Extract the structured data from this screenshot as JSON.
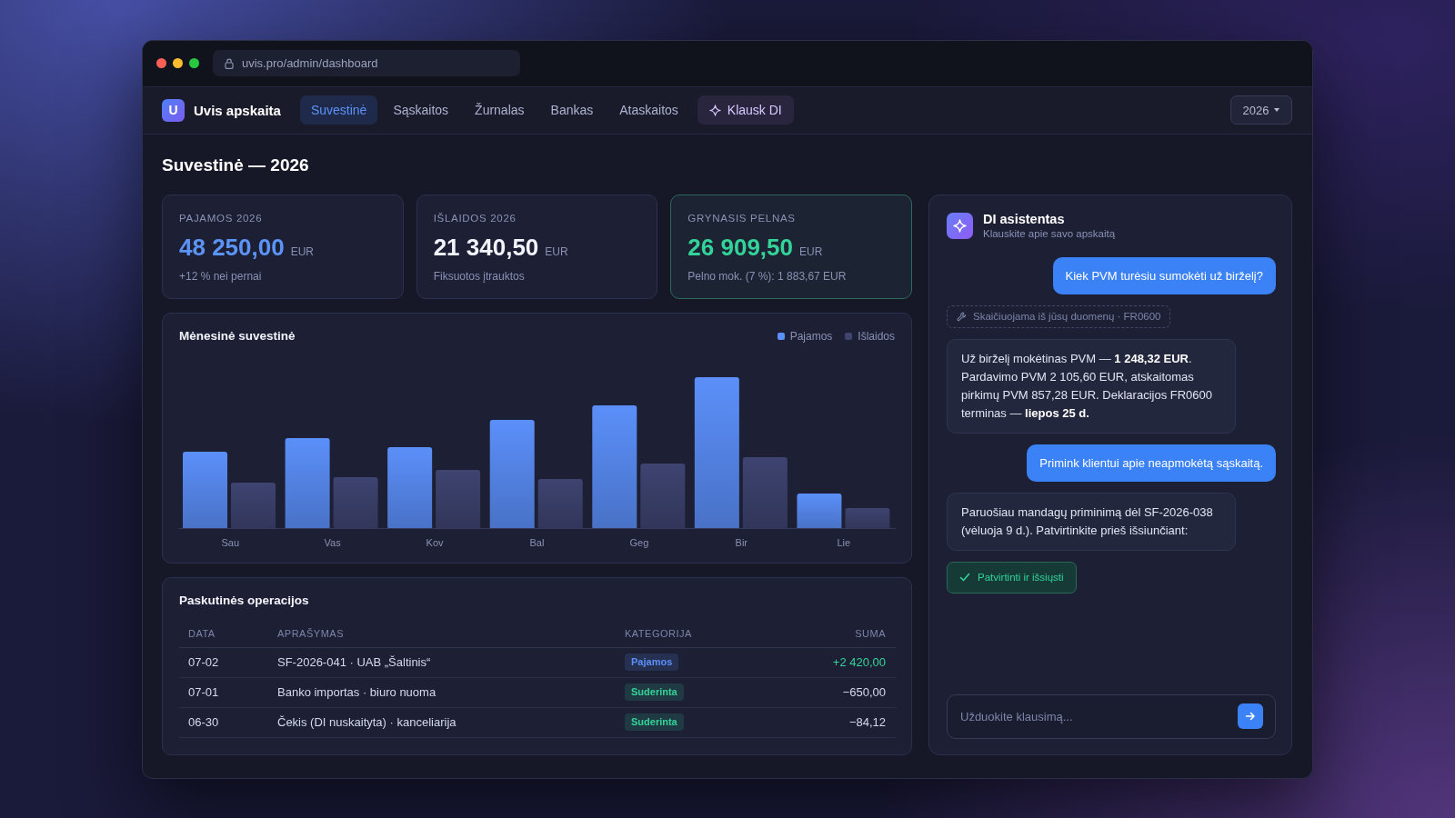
{
  "browser": {
    "url": "uvis.pro/admin/dashboard"
  },
  "app": {
    "logo_letter": "U",
    "name": "Uvis apskaita"
  },
  "tabs": [
    {
      "label": "Suvestinė",
      "selected": true,
      "kind": "page"
    },
    {
      "label": "Sąskaitos",
      "selected": false,
      "kind": "page"
    },
    {
      "label": "Žurnalas",
      "selected": false,
      "kind": "page"
    },
    {
      "label": "Bankas",
      "selected": false,
      "kind": "page"
    },
    {
      "label": "Ataskaitos",
      "selected": false,
      "kind": "page"
    },
    {
      "label": "Klausk DI",
      "selected": false,
      "kind": "assistant"
    }
  ],
  "year_select": {
    "value": "2026"
  },
  "page_title": "Suvestinė — 2026",
  "stats": [
    {
      "label": "PAJAMOS 2026",
      "value": "48 250,00",
      "unit": "EUR",
      "note": "+12 % nei pernai",
      "kind": "income"
    },
    {
      "label": "IŠLAIDOS 2026",
      "value": "21 340,50",
      "unit": "EUR",
      "note": "Fiksuotos įtrauktos",
      "kind": "expense"
    },
    {
      "label": "GRYNASIS PELNAS",
      "value": "26 909,50",
      "unit": "EUR",
      "note": "Pelno mok. (7 %): 1 883,67 EUR",
      "kind": "profit"
    }
  ],
  "monthly_chart": {
    "title": "Mėnesinė suvestinė",
    "legend": [
      {
        "label": "Pajamos",
        "color": "#5b8ff9"
      },
      {
        "label": "Išlaidos",
        "color": "#3e4370"
      }
    ],
    "months": [
      "Sau",
      "Vas",
      "Kov",
      "Bal",
      "Geg",
      "Bir",
      "Lie"
    ]
  },
  "transactions": {
    "title": "Paskutinės operacijos",
    "columns": [
      "DATA",
      "APRAŠYMAS",
      "KATEGORIJA",
      "SUMA"
    ],
    "rows": [
      {
        "date": "07-02",
        "description": "SF-2026-041 · UAB „Šaltinis“",
        "category": {
          "label": "Pajamos",
          "color": "#5b8ff9"
        },
        "amount": "+2 420,00",
        "kind": "income"
      },
      {
        "date": "07-01",
        "description": "Banko importas · biuro nuoma",
        "category": {
          "label": "Suderinta",
          "color": "#34d399"
        },
        "amount": "−650,00",
        "kind": "expense"
      },
      {
        "date": "06-30",
        "description": "Čekis (DI nuskaityta) · kanceliarija",
        "category": {
          "label": "Suderinta",
          "color": "#34d399"
        },
        "amount": "−84,12",
        "kind": "expense"
      }
    ]
  },
  "assistant": {
    "title": "DI asistentas",
    "subtitle": "Klauskite apie savo apskaitą",
    "messages": [
      {
        "kind": "user",
        "text": "Kiek PVM turėsiu sumokėti už birželį?"
      },
      {
        "kind": "tool",
        "text": "Skaičiuojama iš jūsų duomenų · FR0600"
      },
      {
        "kind": "bot",
        "text": "Už birželį mokėtinas PVM — **1 248,32 EUR**. Pardavimo PVM 2 105,60 EUR, atskaitomas pirkimų PVM 857,28 EUR. Deklaracijos FR0600 terminas — **liepos 25 d.**"
      },
      {
        "kind": "user",
        "text": "Primink klientui apie neapmokėtą sąskaitą."
      },
      {
        "kind": "bot",
        "text": "Paruošiau mandagų priminimą dėl SF-2026-038 (vėluoja 9 d.). Patvirtinkite prieš išsiunčiant:"
      },
      {
        "kind": "action",
        "text": "Patvirtinti ir išsiųsti"
      }
    ],
    "input": {
      "placeholder": "Užduokite klausimą..."
    }
  }
}
